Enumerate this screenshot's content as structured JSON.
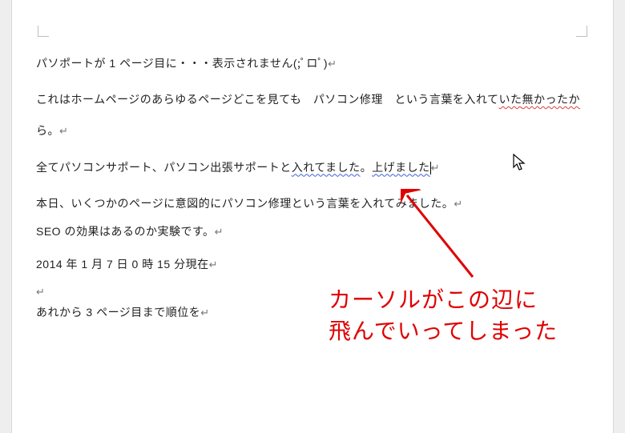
{
  "document": {
    "paragraphs": {
      "p1_run1": "パソポートが 1 ページ目に・・・表示されません(;",
      "p1_err1": "ﾟ",
      "p1_run2": "ロ",
      "p1_err2": "ﾟ",
      "p1_run3": ")",
      "p2_run1": "これはホームページのあらゆるページどこを見ても　パソコン修理　という言葉を入れて",
      "p2_err1": "いた",
      "p2_err2": "無かったか",
      "p2_run2": "ら。",
      "p3_run1": "全てパソコンサポート、パソコン出張サポートと",
      "p3_blue1": "入れてました",
      "p3_run2": "。",
      "p3_blue2": "上げました",
      "p4": "本日、いくつかのページに意図的にパソコン修理という言葉を入れてみました。",
      "p5": "SEO の効果はあるのか実験です。",
      "p6": "2014 年 1 月 7 日 0 時 15 分現在",
      "p7": "",
      "p8": "あれから 3 ページ目まで順位を"
    },
    "paragraph_mark": "↵"
  },
  "annotation": {
    "line1": "カーソルがこの辺に",
    "line2": "飛んでいってしまった"
  },
  "icons": {
    "arrow": "arrow-icon",
    "cursor": "mouse-cursor-icon"
  }
}
